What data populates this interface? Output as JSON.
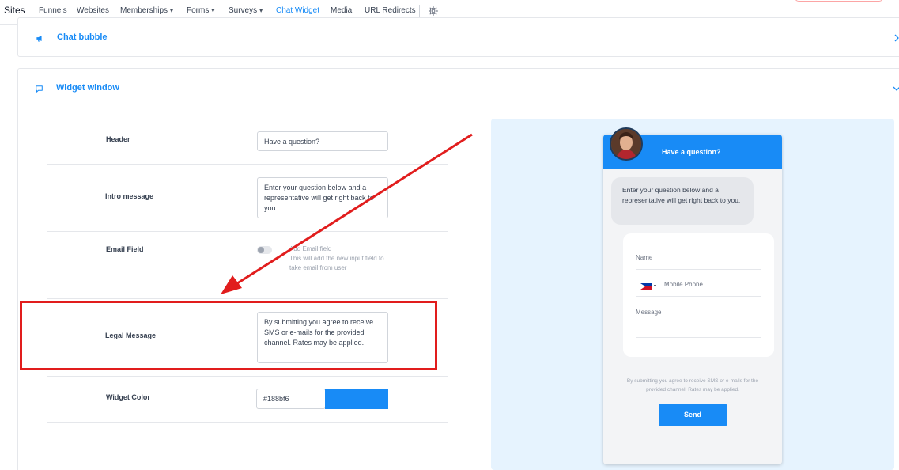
{
  "nav": {
    "brand": "Sites",
    "items": [
      {
        "label": "Funnels",
        "has_dropdown": false
      },
      {
        "label": "Websites",
        "has_dropdown": false
      },
      {
        "label": "Memberships",
        "has_dropdown": true
      },
      {
        "label": "Forms",
        "has_dropdown": true
      },
      {
        "label": "Surveys",
        "has_dropdown": true
      },
      {
        "label": "Chat Widget",
        "has_dropdown": false,
        "active": true
      },
      {
        "label": "Media",
        "has_dropdown": false
      },
      {
        "label": "URL Redirects",
        "has_dropdown": false
      }
    ],
    "chevron": "▾",
    "settings_icon": "gear-icon"
  },
  "panels": {
    "chat_bubble": {
      "title": "Chat bubble",
      "icon": "megaphone-icon",
      "expanded": false
    },
    "widget_window": {
      "title": "Widget window",
      "icon": "chat-icon",
      "expanded": true
    }
  },
  "form": {
    "header": {
      "label": "Header",
      "value": "Have a question?"
    },
    "intro": {
      "label": "Intro message",
      "value": "Enter your question below and a representative will get right back to you."
    },
    "email_field": {
      "label": "Email Field",
      "toggle_title": "Add Email field",
      "toggle_desc": "This will add the new input field to take email from user",
      "enabled": false
    },
    "legal": {
      "label": "Legal Message",
      "value": "By submitting you agree to receive SMS or e-mails for the provided channel. Rates may be applied."
    },
    "widget_color": {
      "label": "Widget Color",
      "value": "#188bf6"
    }
  },
  "preview": {
    "header_title": "Have a question?",
    "intro": "Enter your question below and a representative will get right back to you.",
    "name_label": "Name",
    "phone_placeholder": "Mobile Phone",
    "message_label": "Message",
    "legal": "By submitting you agree to receive SMS or e-mails for the provided channel. Rates may be applied.",
    "send_label": "Send"
  },
  "colors": {
    "accent": "#188bf6",
    "annotation": "#e11d1d",
    "preview_bg": "#e6f3fe"
  }
}
